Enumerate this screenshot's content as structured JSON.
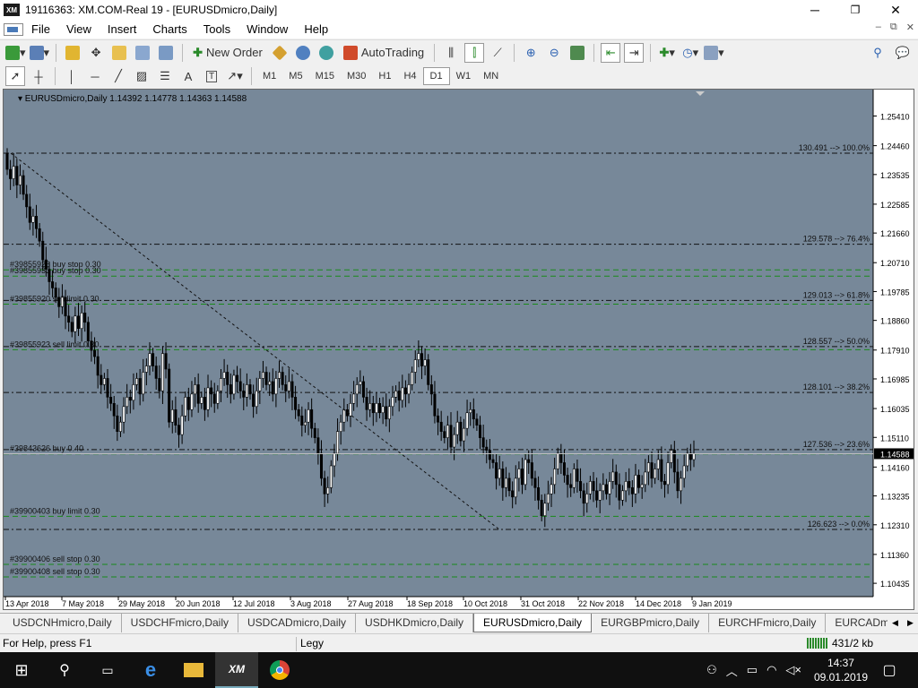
{
  "window": {
    "title": "19116363: XM.COM-Real 19 - [EURUSDmicro,Daily]",
    "logo": "XM",
    "minimize": "─",
    "maximize": "❐",
    "close": "✕"
  },
  "menu": [
    "File",
    "View",
    "Insert",
    "Charts",
    "Tools",
    "Window",
    "Help"
  ],
  "mdi_controls": [
    "–",
    "⧉",
    "✕"
  ],
  "toolbar": {
    "new_order": "New Order",
    "autotrading": "AutoTrading"
  },
  "timeframes": [
    "M1",
    "M5",
    "M15",
    "M30",
    "H1",
    "H4",
    "D1",
    "W1",
    "MN"
  ],
  "active_timeframe": "D1",
  "drawing_tools": {
    "text_label": "A",
    "text_box": "T"
  },
  "chart_data": {
    "type": "candlestick",
    "title": "EURUSDmicro,Daily",
    "ohlc_header": "1.14392 1.14778 1.14363 1.14588",
    "ylim": [
      1.0995,
      1.262
    ],
    "price_ticks": [
      "1.25410",
      "1.24460",
      "1.23535",
      "1.22585",
      "1.21660",
      "1.20710",
      "1.19785",
      "1.18860",
      "1.17910",
      "1.16985",
      "1.16035",
      "1.15110",
      "1.14160",
      "1.13235",
      "1.12310",
      "1.11360",
      "1.10435"
    ],
    "current_price": "1.14588",
    "date_ticks": [
      "13 Apr 2018",
      "7 May 2018",
      "29 May 2018",
      "20 Jun 2018",
      "12 Jul 2018",
      "3 Aug 2018",
      "27 Aug 2018",
      "18 Sep 2018",
      "10 Oct 2018",
      "31 Oct 2018",
      "22 Nov 2018",
      "14 Dec 2018",
      "9 Jan 2019"
    ],
    "fibo_levels": [
      {
        "price": 1.2422,
        "label": "130.491 --> 100.0%"
      },
      {
        "price": 1.213,
        "label": "129.578 --> 76.4%"
      },
      {
        "price": 1.195,
        "label": "129.013 --> 61.8%"
      },
      {
        "price": 1.1802,
        "label": "128.557 --> 50.0%"
      },
      {
        "price": 1.1655,
        "label": "128.101 --> 38.2%"
      },
      {
        "price": 1.1472,
        "label": "127.536 --> 23.6%"
      },
      {
        "price": 1.1216,
        "label": "126.623 --> 0.0%"
      }
    ],
    "orders": [
      {
        "price": 1.2048,
        "label": "#39855926 buy stop 0.30"
      },
      {
        "price": 1.2028,
        "label": "#39855933 buy stop 0.30"
      },
      {
        "price": 1.1938,
        "label": "#39855920 sell limit 0.30"
      },
      {
        "price": 1.1792,
        "label": "#39855923 sell limit 0.30"
      },
      {
        "price": 1.1458,
        "label": "#39843626 buy 0.40"
      },
      {
        "price": 1.1258,
        "label": "#39900403 buy limit 0.30"
      },
      {
        "price": 1.1104,
        "label": "#39900406 sell stop 0.30"
      },
      {
        "price": 1.1064,
        "label": "#39900408 sell stop 0.30"
      }
    ],
    "closes": [
      1.237,
      1.234,
      1.238,
      1.232,
      1.235,
      1.229,
      1.225,
      1.22,
      1.222,
      1.218,
      1.214,
      1.208,
      1.205,
      1.201,
      1.199,
      1.196,
      1.193,
      1.196,
      1.19,
      1.188,
      1.185,
      1.19,
      1.186,
      1.191,
      1.188,
      1.182,
      1.179,
      1.177,
      1.171,
      1.168,
      1.17,
      1.164,
      1.162,
      1.158,
      1.153,
      1.156,
      1.161,
      1.164,
      1.163,
      1.168,
      1.17,
      1.165,
      1.172,
      1.174,
      1.178,
      1.174,
      1.17,
      1.166,
      1.178,
      1.173,
      1.156,
      1.16,
      1.155,
      1.152,
      1.158,
      1.164,
      1.16,
      1.165,
      1.168,
      1.162,
      1.164,
      1.16,
      1.167,
      1.165,
      1.162,
      1.166,
      1.17,
      1.172,
      1.168,
      1.165,
      1.171,
      1.169,
      1.166,
      1.164,
      1.168,
      1.165,
      1.161,
      1.166,
      1.17,
      1.172,
      1.168,
      1.169,
      1.165,
      1.17,
      1.172,
      1.168,
      1.166,
      1.169,
      1.164,
      1.16,
      1.158,
      1.155,
      1.156,
      1.16,
      1.154,
      1.151,
      1.146,
      1.138,
      1.133,
      1.135,
      1.142,
      1.146,
      1.153,
      1.156,
      1.16,
      1.158,
      1.162,
      1.165,
      1.168,
      1.169,
      1.164,
      1.16,
      1.162,
      1.159,
      1.162,
      1.159,
      1.161,
      1.157,
      1.161,
      1.164,
      1.166,
      1.163,
      1.167,
      1.165,
      1.168,
      1.172,
      1.176,
      1.178,
      1.174,
      1.176,
      1.168,
      1.165,
      1.158,
      1.156,
      1.153,
      1.151,
      1.155,
      1.148,
      1.152,
      1.156,
      1.15,
      1.154,
      1.159,
      1.16,
      1.157,
      1.155,
      1.151,
      1.148,
      1.147,
      1.144,
      1.143,
      1.138,
      1.141,
      1.135,
      1.138,
      1.134,
      1.132,
      1.138,
      1.141,
      1.136,
      1.144,
      1.143,
      1.138,
      1.135,
      1.131,
      1.126,
      1.13,
      1.133,
      1.136,
      1.141,
      1.146,
      1.143,
      1.139,
      1.136,
      1.135,
      1.141,
      1.137,
      1.134,
      1.13,
      1.133,
      1.137,
      1.134,
      1.131,
      1.134,
      1.136,
      1.133,
      1.137,
      1.14,
      1.136,
      1.131,
      1.134,
      1.137,
      1.135,
      1.133,
      1.139,
      1.135,
      1.136,
      1.14,
      1.143,
      1.138,
      1.141,
      1.144,
      1.137,
      1.136,
      1.143,
      1.147,
      1.14,
      1.134,
      1.138,
      1.142,
      1.146,
      1.144,
      1.1459
    ]
  },
  "tabs": [
    "USDCNHmicro,Daily",
    "USDCHFmicro,Daily",
    "USDCADmicro,Daily",
    "USDHKDmicro,Daily",
    "EURUSDmicro,Daily",
    "EURGBPmicro,Daily",
    "EURCHFmicro,Daily",
    "EURCADmicro,"
  ],
  "active_tab": 4,
  "status": {
    "help": "For Help, press F1",
    "profile": "Legy",
    "traffic": "431/2 kb"
  },
  "taskbar": {
    "time": "14:37",
    "date": "09.01.2019",
    "xm": "XM"
  }
}
